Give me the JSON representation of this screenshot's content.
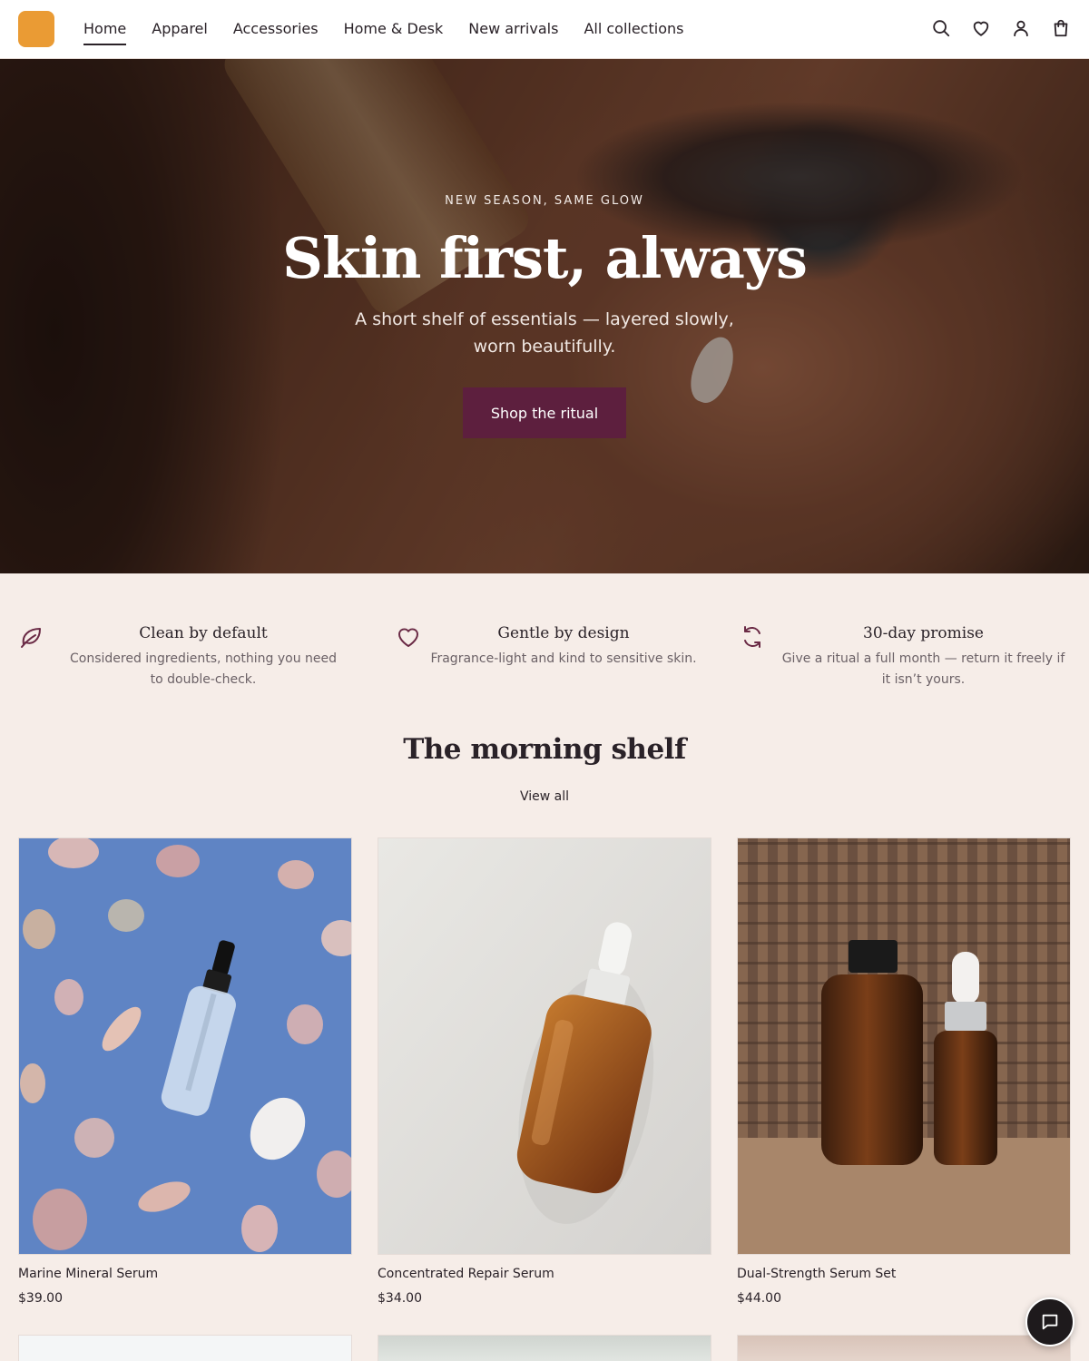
{
  "header": {
    "logo_color": "#ea9b34",
    "nav": [
      {
        "label": "Home",
        "active": true
      },
      {
        "label": "Apparel"
      },
      {
        "label": "Accessories"
      },
      {
        "label": "Home & Desk"
      },
      {
        "label": "New arrivals"
      },
      {
        "label": "All collections"
      }
    ],
    "icons": [
      "search-icon",
      "wishlist-heart-icon",
      "account-icon",
      "cart-bag-icon"
    ]
  },
  "hero": {
    "eyebrow": "NEW SEASON, SAME GLOW",
    "title": "Skin first, always",
    "subtitle": "A short shelf of essentials — layered slowly, worn beautifully.",
    "cta_label": "Shop the ritual",
    "cta_color": "#5d1f3e"
  },
  "features": [
    {
      "icon": "leaf-icon",
      "title": "Clean by default",
      "text": "Considered ingredients, nothing you need to double-check."
    },
    {
      "icon": "heart-icon",
      "title": "Gentle by design",
      "text": "Fragrance-light and kind to sensitive skin."
    },
    {
      "icon": "refresh-icon",
      "title": "30-day promise",
      "text": "Give a ritual a full month — return it freely if it isn’t yours."
    }
  ],
  "section": {
    "title": "The morning shelf",
    "view_all": "View all"
  },
  "products": [
    {
      "name": "Marine Mineral Serum",
      "price": "$39.00"
    },
    {
      "name": "Concentrated Repair Serum",
      "price": "$34.00"
    },
    {
      "name": "Dual-Strength Serum Set",
      "price": "$44.00"
    }
  ],
  "chat": {
    "icon": "chat-bubble-icon"
  },
  "colors": {
    "background": "#f6ede8",
    "text": "#2a2228",
    "muted_text": "#6b6166",
    "accent": "#5d1f3e",
    "icon_accent": "#6a2a45"
  }
}
